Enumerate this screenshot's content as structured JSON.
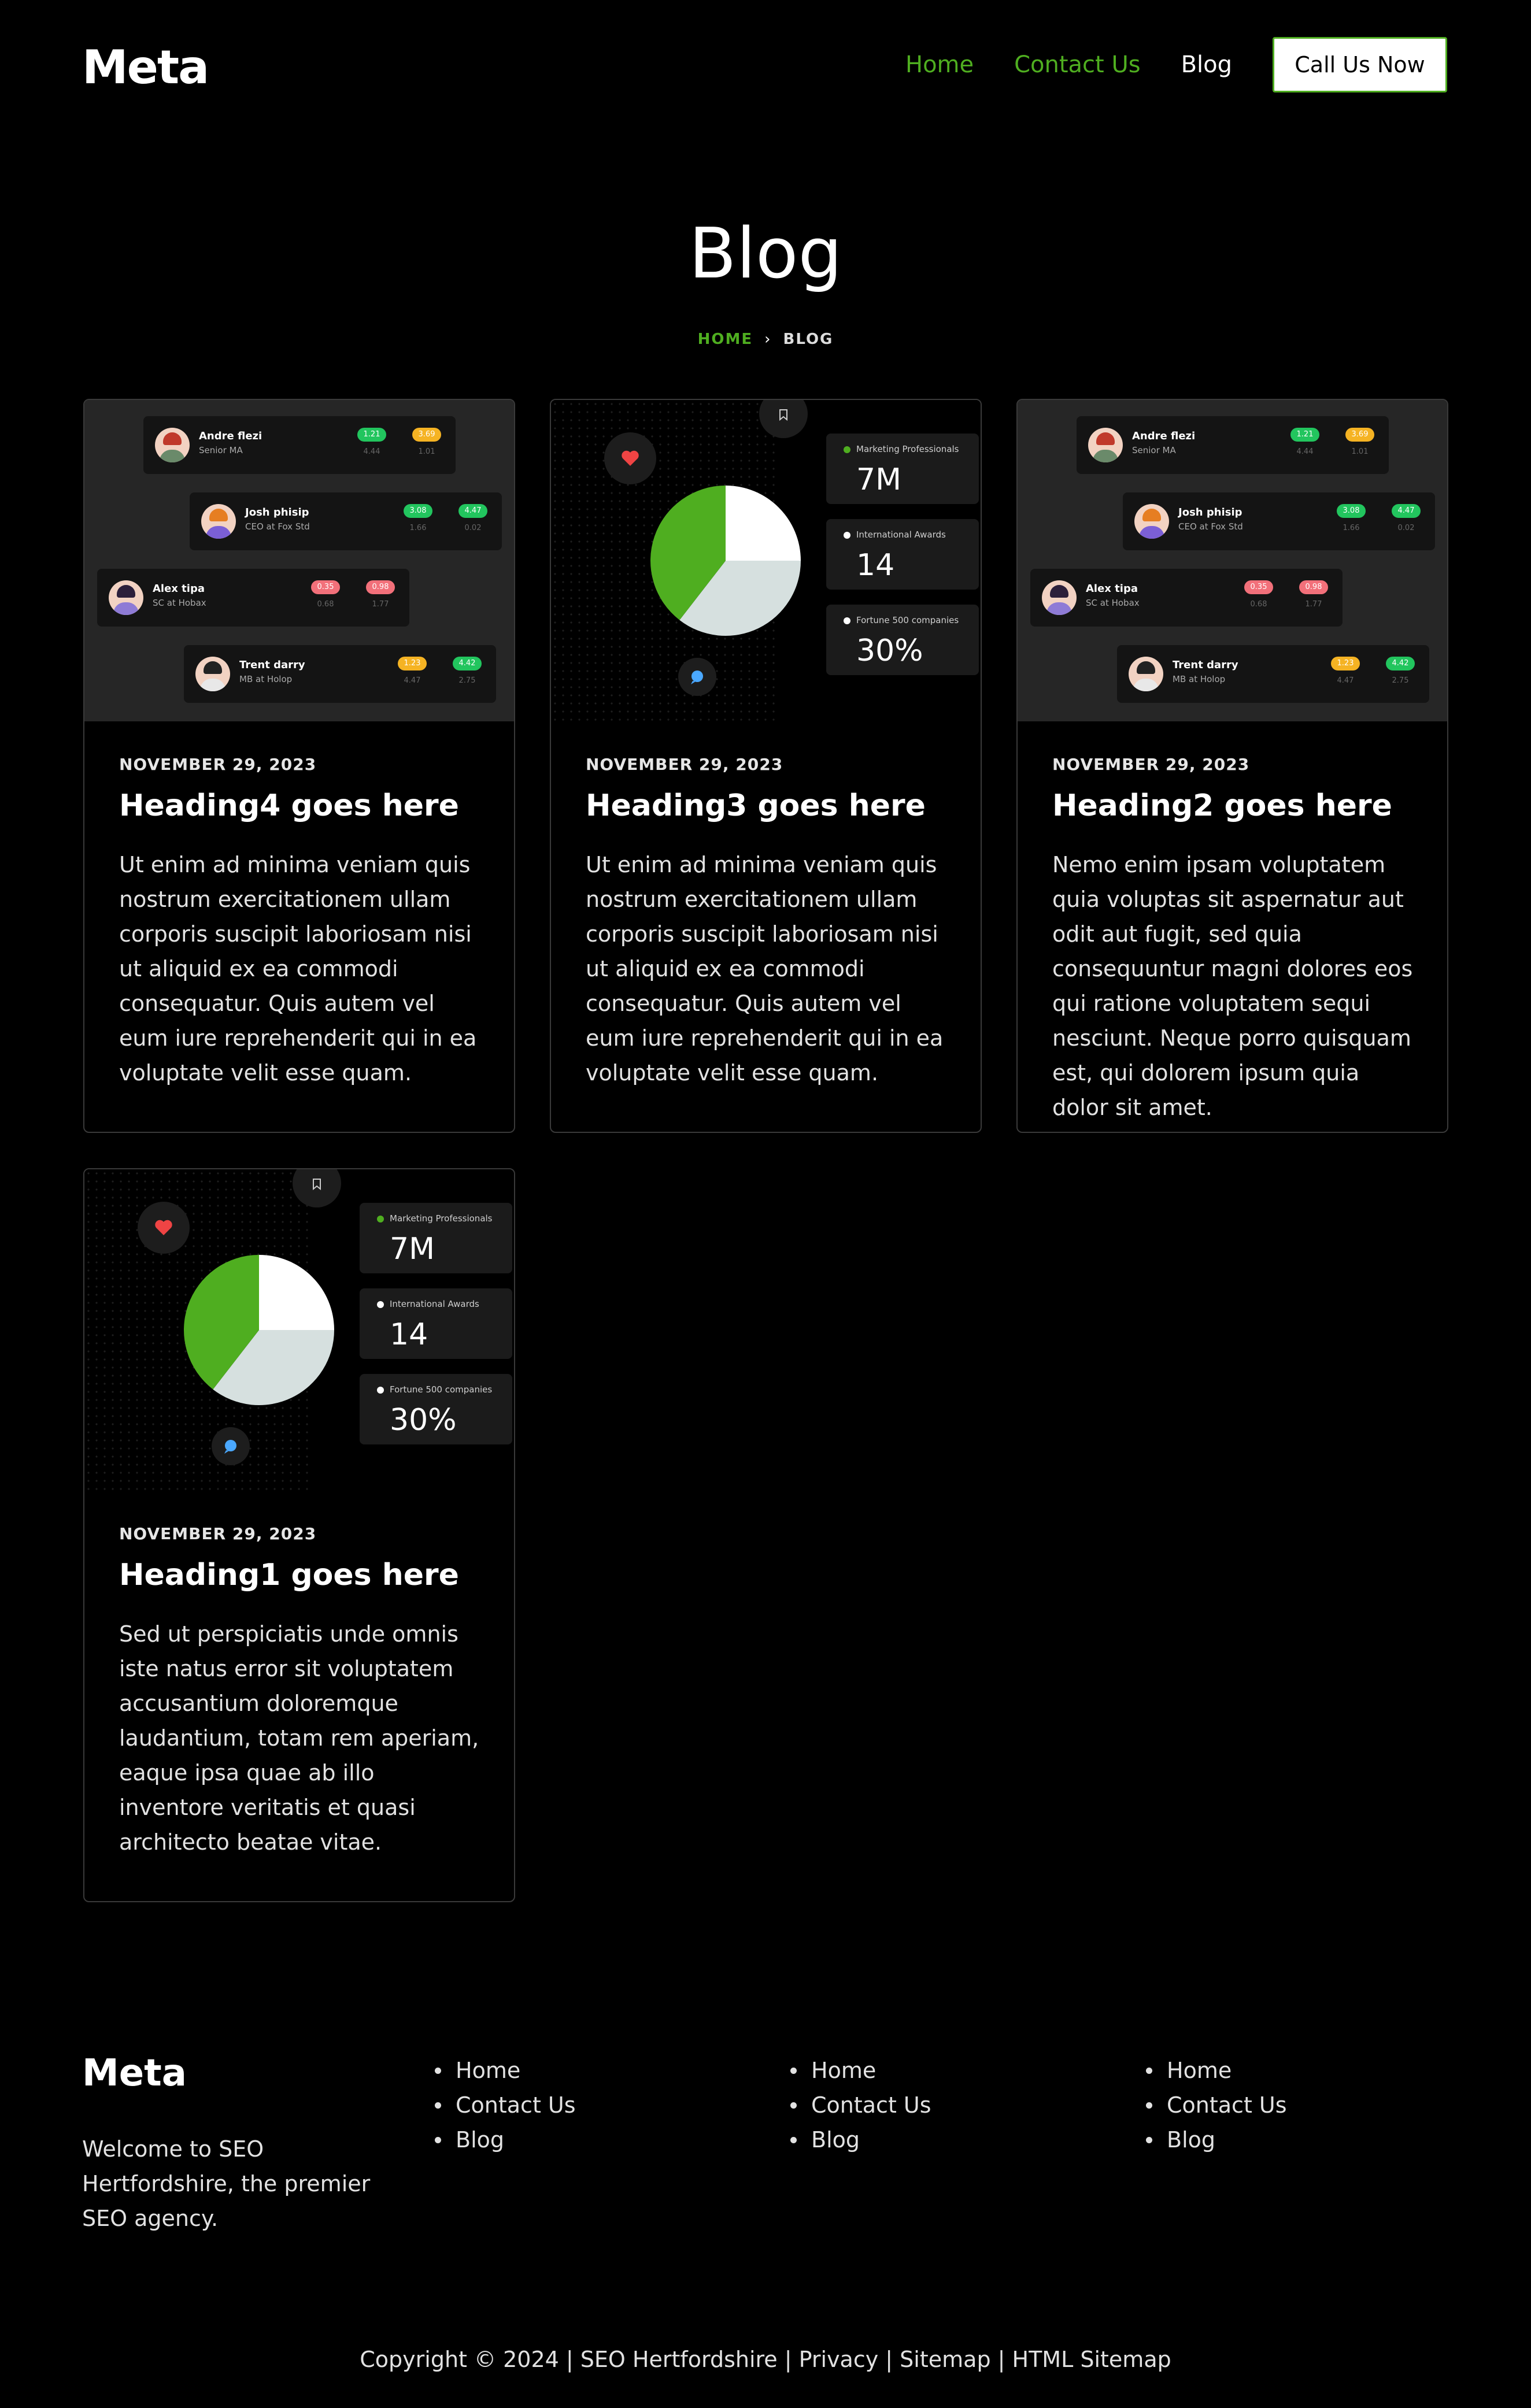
{
  "header": {
    "logo": "Meta",
    "nav": [
      "Home",
      "Contact Us",
      "Blog"
    ],
    "cta": "Call Us Now"
  },
  "hero": {
    "title": "Blog",
    "breadcrumb_home": "HOME",
    "breadcrumb_current": "BLOG"
  },
  "people": [
    {
      "name": "Andre flezi",
      "role": "Senior MA",
      "v1": "1.21",
      "s1": "4.44",
      "v2": "3.69",
      "s2": "1.01",
      "c1": "green",
      "c2": "yellow"
    },
    {
      "name": "Josh phisip",
      "role": "CEO at Fox Std",
      "v1": "3.08",
      "s1": "1.66",
      "v2": "4.47",
      "s2": "0.02",
      "c1": "green",
      "c2": "green"
    },
    {
      "name": "Alex tipa",
      "role": "SC at Hobax",
      "v1": "0.35",
      "s1": "0.68",
      "v2": "0.98",
      "s2": "1.77",
      "c1": "red",
      "c2": "red"
    },
    {
      "name": "Trent darry",
      "role": "MB at Holop",
      "v1": "1.23",
      "s1": "4.47",
      "v2": "4.42",
      "s2": "2.75",
      "c1": "yellow",
      "c2": "green"
    }
  ],
  "stats": [
    {
      "label": "Marketing Professionals",
      "value": "7M",
      "dot": "green"
    },
    {
      "label": "International Awards",
      "value": "14",
      "dot": "white"
    },
    {
      "label": "Fortune 500 companies",
      "value": "30%",
      "dot": "white"
    }
  ],
  "pie": {
    "slices": [
      {
        "name": "white",
        "fraction": 0.25,
        "color": "#ffffff"
      },
      {
        "name": "gray",
        "fraction": 0.355,
        "color": "#d6e0df"
      },
      {
        "name": "green",
        "fraction": 0.395,
        "color": "#4fae20"
      }
    ]
  },
  "posts": [
    {
      "date": "NOVEMBER 29, 2023",
      "heading": "Heading4 goes here",
      "excerpt": "Ut enim ad minima veniam quis nostrum exercitationem ullam corporis suscipit laboriosam nisi ut aliquid ex ea commodi consequatur. Quis autem vel eum iure reprehenderit qui in ea voluptate velit esse quam.",
      "thumb": "people"
    },
    {
      "date": "NOVEMBER 29, 2023",
      "heading": "Heading3 goes here",
      "excerpt": "Ut enim ad minima veniam quis nostrum exercitationem ullam corporis suscipit laboriosam nisi ut aliquid ex ea commodi consequatur. Quis autem vel eum iure reprehenderit qui in ea voluptate velit esse quam.",
      "thumb": "pie"
    },
    {
      "date": "NOVEMBER 29, 2023",
      "heading": "Heading2 goes here",
      "excerpt": "Nemo enim ipsam voluptatem quia voluptas sit aspernatur aut odit aut fugit, sed quia consequuntur magni dolores eos qui ratione voluptatem sequi nesciunt. Neque porro quisquam est, qui dolorem ipsum quia dolor sit amet.",
      "thumb": "people"
    },
    {
      "date": "NOVEMBER 29, 2023",
      "heading": "Heading1 goes here",
      "excerpt": "Sed ut perspiciatis unde omnis iste natus error sit voluptatem accusantium doloremque laudantium, totam rem aperiam, eaque ipsa quae ab illo inventore veritatis et quasi architecto beatae vitae.",
      "thumb": "pie"
    }
  ],
  "footer": {
    "logo": "Meta",
    "about": "Welcome to SEO Hertfordshire, the premier SEO agency.",
    "columns": [
      [
        "Home",
        "Contact Us",
        "Blog"
      ],
      [
        "Home",
        "Contact Us",
        "Blog"
      ],
      [
        "Home",
        "Contact Us",
        "Blog"
      ]
    ],
    "copyright": "Copyright © 2024 | SEO Hertfordshire | Privacy | Sitemap | HTML Sitemap"
  },
  "colors": {
    "accent": "#4fae20",
    "background": "#000000",
    "card_border": "#3a3a3a"
  }
}
